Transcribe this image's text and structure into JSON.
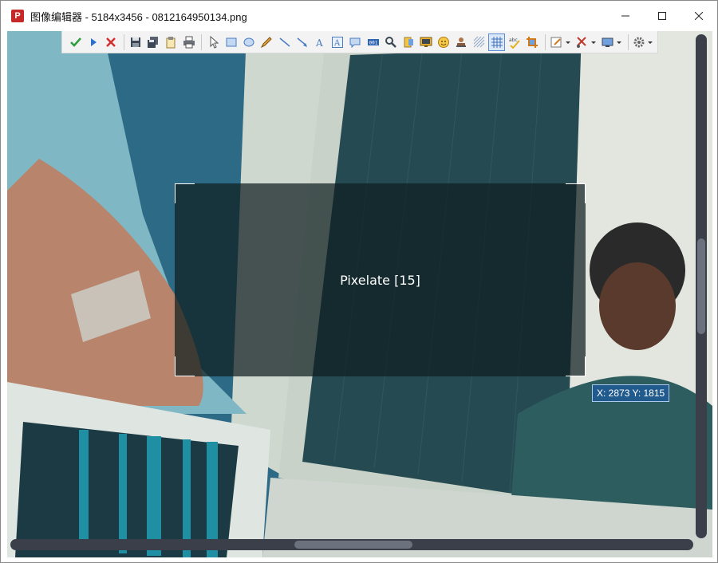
{
  "window": {
    "title": "图像编辑器 - 5184x3456 - 0812164950134.png",
    "icon": "app-icon"
  },
  "toolbar": {
    "items": [
      "confirm-icon",
      "next-icon",
      "cancel-icon",
      "save-icon",
      "save-as-icon",
      "clipboard-icon",
      "print-icon",
      "pointer-icon",
      "rectangle-icon",
      "ellipse-icon",
      "pencil-icon",
      "line-icon",
      "arrow-icon",
      "text-icon",
      "textbox-icon",
      "speech-bubble-icon",
      "counter-icon",
      "magnifier-icon",
      "highlight-icon",
      "monitor-icon",
      "emoji-icon",
      "stamp-icon",
      "blur-icon",
      "pixelate-icon",
      "spellcheck-icon",
      "crop-icon"
    ],
    "active_tool": "pixelate-icon"
  },
  "selection": {
    "label": "Pixelate [15]"
  },
  "cursor": {
    "coords": "X: 2873 Y: 1815"
  },
  "colors": {
    "confirm": "#2e9e3e",
    "next": "#2b6fcf",
    "cancel": "#d32f2f",
    "accent": "#5b8dd6"
  }
}
